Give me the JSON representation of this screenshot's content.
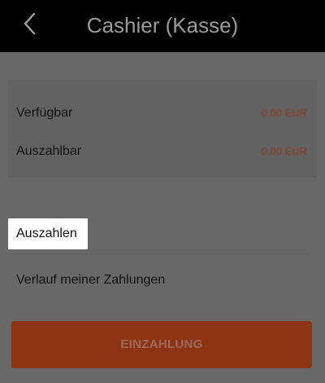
{
  "header": {
    "title": "Cashier (Kasse)",
    "back_icon": "chevron-left-icon"
  },
  "balances": [
    {
      "label": "Verfügbar",
      "value": "0,00 EUR"
    },
    {
      "label": "Auszahlbar",
      "value": "0,00 EUR"
    }
  ],
  "menu": {
    "withdraw_label": "Auszahlen",
    "history_label": "Verlauf meiner Zahlungen"
  },
  "deposit_button": {
    "label": "EINZAHLUNG"
  },
  "colors": {
    "header_bg": "#000000",
    "overlay_bg": "#686868",
    "highlight_bg": "#ffffff",
    "accent": "#8d3414"
  }
}
